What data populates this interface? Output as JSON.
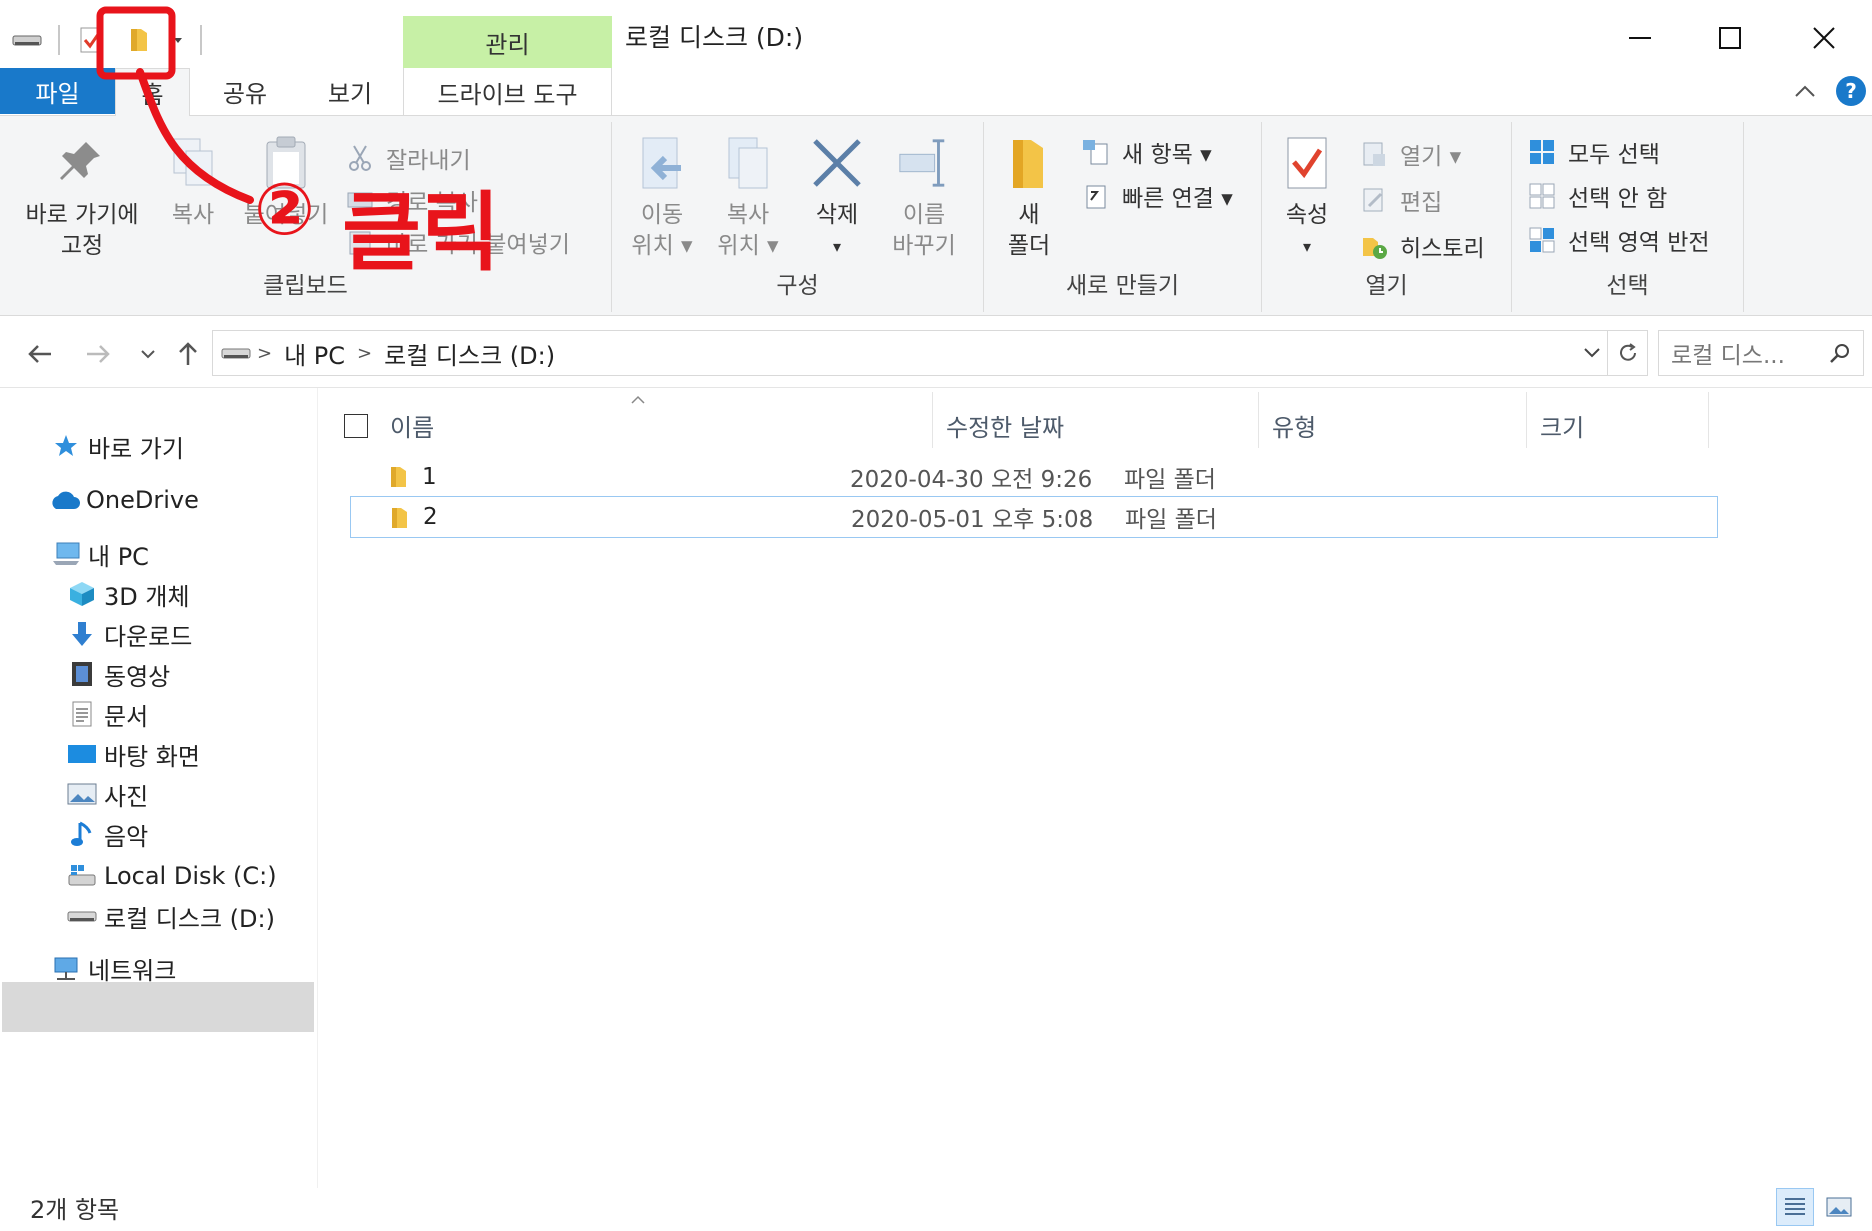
{
  "window": {
    "title": "로컬 디스크 (D:)",
    "context_tab": "관리"
  },
  "tabs": {
    "file": "파일",
    "home": "홈",
    "share": "공유",
    "view": "보기",
    "drive_tools": "드라이브 도구"
  },
  "ribbon": {
    "clipboard": {
      "label": "클립보드",
      "pin_line1": "바로 가기에",
      "pin_line2": "고정",
      "copy": "복사",
      "paste": "붙여넣기",
      "cut": "잘라내기",
      "copy_path": "경로 복사",
      "paste_shortcut": "바로 가기 붙여넣기"
    },
    "organize": {
      "label": "구성",
      "move_line1": "이동",
      "move_line2": "위치 ▾",
      "copyto_line1": "복사",
      "copyto_line2": "위치 ▾",
      "delete": "삭제",
      "delete_arrow": "▾",
      "rename_line1": "이름",
      "rename_line2": "바꾸기"
    },
    "new": {
      "label": "새로 만들기",
      "newfolder_line1": "새",
      "newfolder_line2": "폴더",
      "new_item": "새 항목 ▾",
      "easy_access": "빠른 연결 ▾"
    },
    "open": {
      "label": "열기",
      "properties": "속성",
      "properties_arrow": "▾",
      "open": "열기 ▾",
      "edit": "편집",
      "history": "히스토리"
    },
    "select": {
      "label": "선택",
      "select_all": "모두 선택",
      "select_none": "선택 안 함",
      "invert": "선택 영역 반전"
    }
  },
  "address": {
    "crumbs": [
      "내 PC",
      "로컬 디스크 (D:)"
    ],
    "search_placeholder": "로컬 디스..."
  },
  "nav": {
    "quick_access": "바로 가기",
    "onedrive": "OneDrive",
    "this_pc": "내 PC",
    "objects3d": "3D 개체",
    "downloads": "다운로드",
    "videos": "동영상",
    "documents": "문서",
    "desktop": "바탕 화면",
    "pictures": "사진",
    "music": "음악",
    "local_c": "Local Disk (C:)",
    "local_d": "로컬 디스크 (D:)",
    "network": "네트워크"
  },
  "columns": {
    "name": "이름",
    "modified": "수정한 날짜",
    "type": "유형",
    "size": "크기"
  },
  "files": [
    {
      "name": "1",
      "modified": "2020-04-30 오전 9:26",
      "type": "파일 폴더"
    },
    {
      "name": "2",
      "modified": "2020-05-01 오후 5:08",
      "type": "파일 폴더"
    }
  ],
  "status": {
    "count": "2개 항목"
  },
  "annotation": {
    "number": "②",
    "text": "클릭",
    "color": "#e8141b"
  },
  "colors": {
    "file_tab": "#1979ca",
    "manage_tab": "#c7f0a6",
    "selection_border": "#99c8f2",
    "folder": "#f3c447"
  }
}
